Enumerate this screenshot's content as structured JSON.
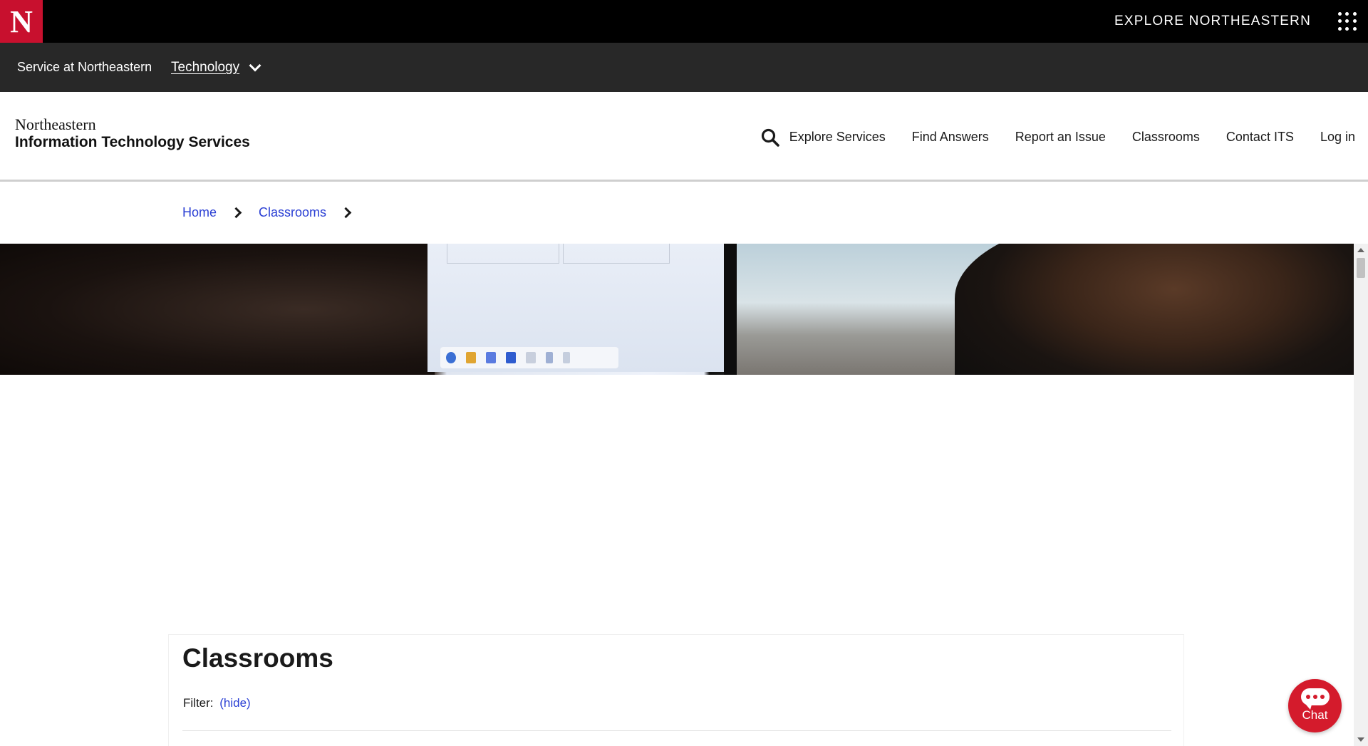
{
  "topbar": {
    "logo_letter": "N",
    "explore_label": "EXPLORE NORTHEASTERN",
    "apps_icon": "grid-dots-icon"
  },
  "subbar": {
    "service_label": "Service at Northeastern",
    "section_label": "Technology",
    "section_icon": "chevron-down-icon"
  },
  "header": {
    "brand_line1": "Northeastern",
    "brand_line2": "Information Technology Services",
    "search_icon": "search-icon",
    "nav": [
      {
        "label": "Explore Services"
      },
      {
        "label": "Find Answers"
      },
      {
        "label": "Report an Issue"
      },
      {
        "label": "Classrooms"
      },
      {
        "label": "Contact ITS"
      },
      {
        "label": "Log in"
      }
    ]
  },
  "breadcrumb": {
    "items": [
      "Home",
      "Classrooms"
    ]
  },
  "content": {
    "title": "Classrooms",
    "filter_label": "Filter:",
    "filter_toggle": "(hide)"
  },
  "chat": {
    "label": "Chat",
    "icon": "chat-bubble-icon"
  },
  "colors": {
    "brand_red": "#c8102e",
    "link_blue": "#2a3fd4",
    "topbar_bg": "#000000",
    "subbar_bg": "#282828"
  }
}
